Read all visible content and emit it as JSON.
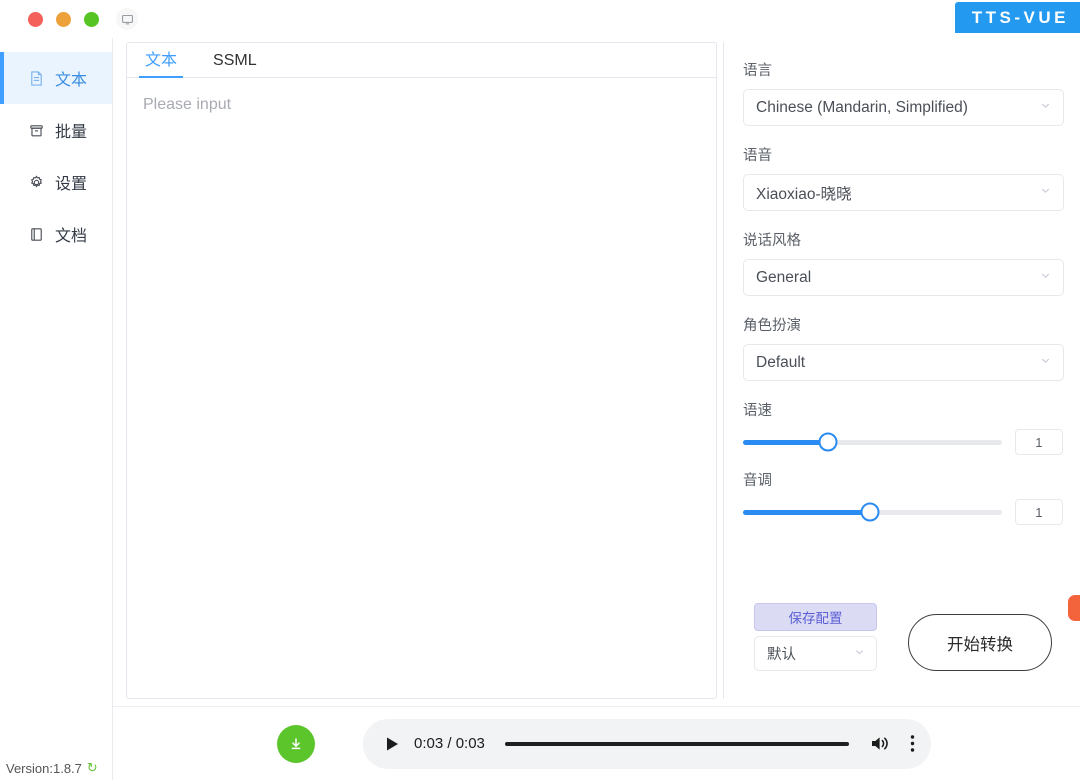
{
  "titlebar": {
    "app_title": "TTS-VUE",
    "badge_color": "#2499f0",
    "window_controls": [
      "close",
      "minimize",
      "maximize"
    ],
    "screen_icon": "monitor-icon"
  },
  "sidebar": {
    "items": [
      {
        "label": "文本",
        "icon": "document-icon",
        "active": true
      },
      {
        "label": "批量",
        "icon": "archive-box-icon",
        "active": false
      },
      {
        "label": "设置",
        "icon": "gear-icon",
        "active": false
      },
      {
        "label": "文档",
        "icon": "book-icon",
        "active": false
      }
    ],
    "version_label": "Version:1.8.7",
    "refresh_icon": "refresh-icon"
  },
  "editor": {
    "tabs": [
      {
        "label": "文本",
        "active": true
      },
      {
        "label": "SSML",
        "active": false
      }
    ],
    "placeholder": "Please input",
    "value": ""
  },
  "settings": {
    "language": {
      "label": "语言",
      "value": "Chinese (Mandarin, Simplified)"
    },
    "voice": {
      "label": "语音",
      "value": "Xiaoxiao-晓晓"
    },
    "style": {
      "label": "说话风格",
      "value": "General"
    },
    "role": {
      "label": "角色扮演",
      "value": "Default"
    },
    "rate": {
      "label": "语速",
      "value": "1",
      "percent": 33
    },
    "pitch": {
      "label": "音调",
      "value": "1",
      "percent": 49
    },
    "save_label": "保存配置",
    "preset_value": "默认",
    "convert_label": "开始转换"
  },
  "player": {
    "download_icon": "download-icon",
    "play_icon": "play-icon",
    "time": "0:03 / 0:03",
    "progress_percent": 100,
    "volume_icon": "volume-icon",
    "menu_icon": "kebab-menu-icon"
  }
}
